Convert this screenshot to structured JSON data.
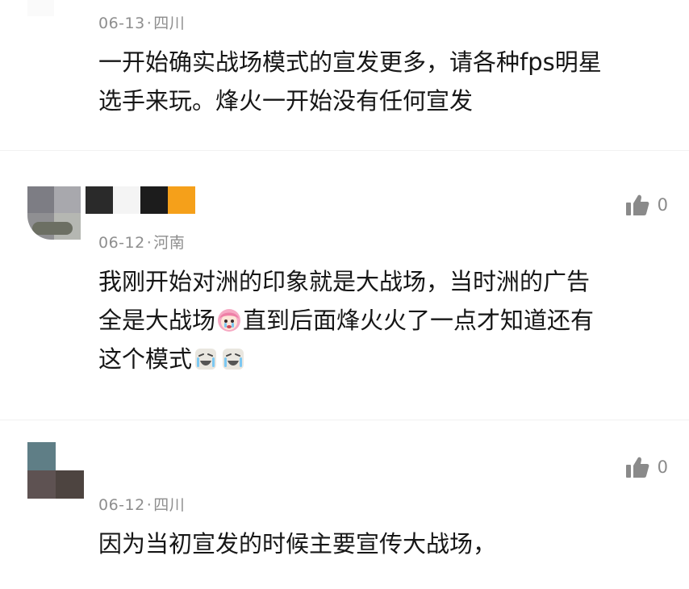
{
  "comments": [
    {
      "date": "06-13",
      "location": "四川",
      "separator": "·",
      "lines": [
        "一开始确实战场模式的宣发更多，请各种fps明星",
        "选手来玩。烽火一开始没有任何宣发"
      ]
    },
    {
      "date": "06-12",
      "location": "河南",
      "separator": "·",
      "likes": "0",
      "line1": "我刚开始对洲的印象就是大战场，当时洲的广告",
      "line2_a": "全是大战场",
      "line2_b": "直到后面烽火火了一点才知道还有",
      "line3": "这个模式"
    },
    {
      "date": "06-12",
      "location": "四川",
      "separator": "·",
      "likes": "0",
      "line1": "因为当初宣发的时候主要宣传大战场，"
    }
  ],
  "colors": {
    "meta": "#8e8e8e",
    "text": "#161616",
    "like": "#8a8a8a",
    "accent": "#f5a01a"
  },
  "icons": {
    "like": "thumbs-up-icon",
    "emoji_pink": "pink-hair-crying-emoji",
    "emoji_laugh": "laughing-tears-emoji"
  }
}
